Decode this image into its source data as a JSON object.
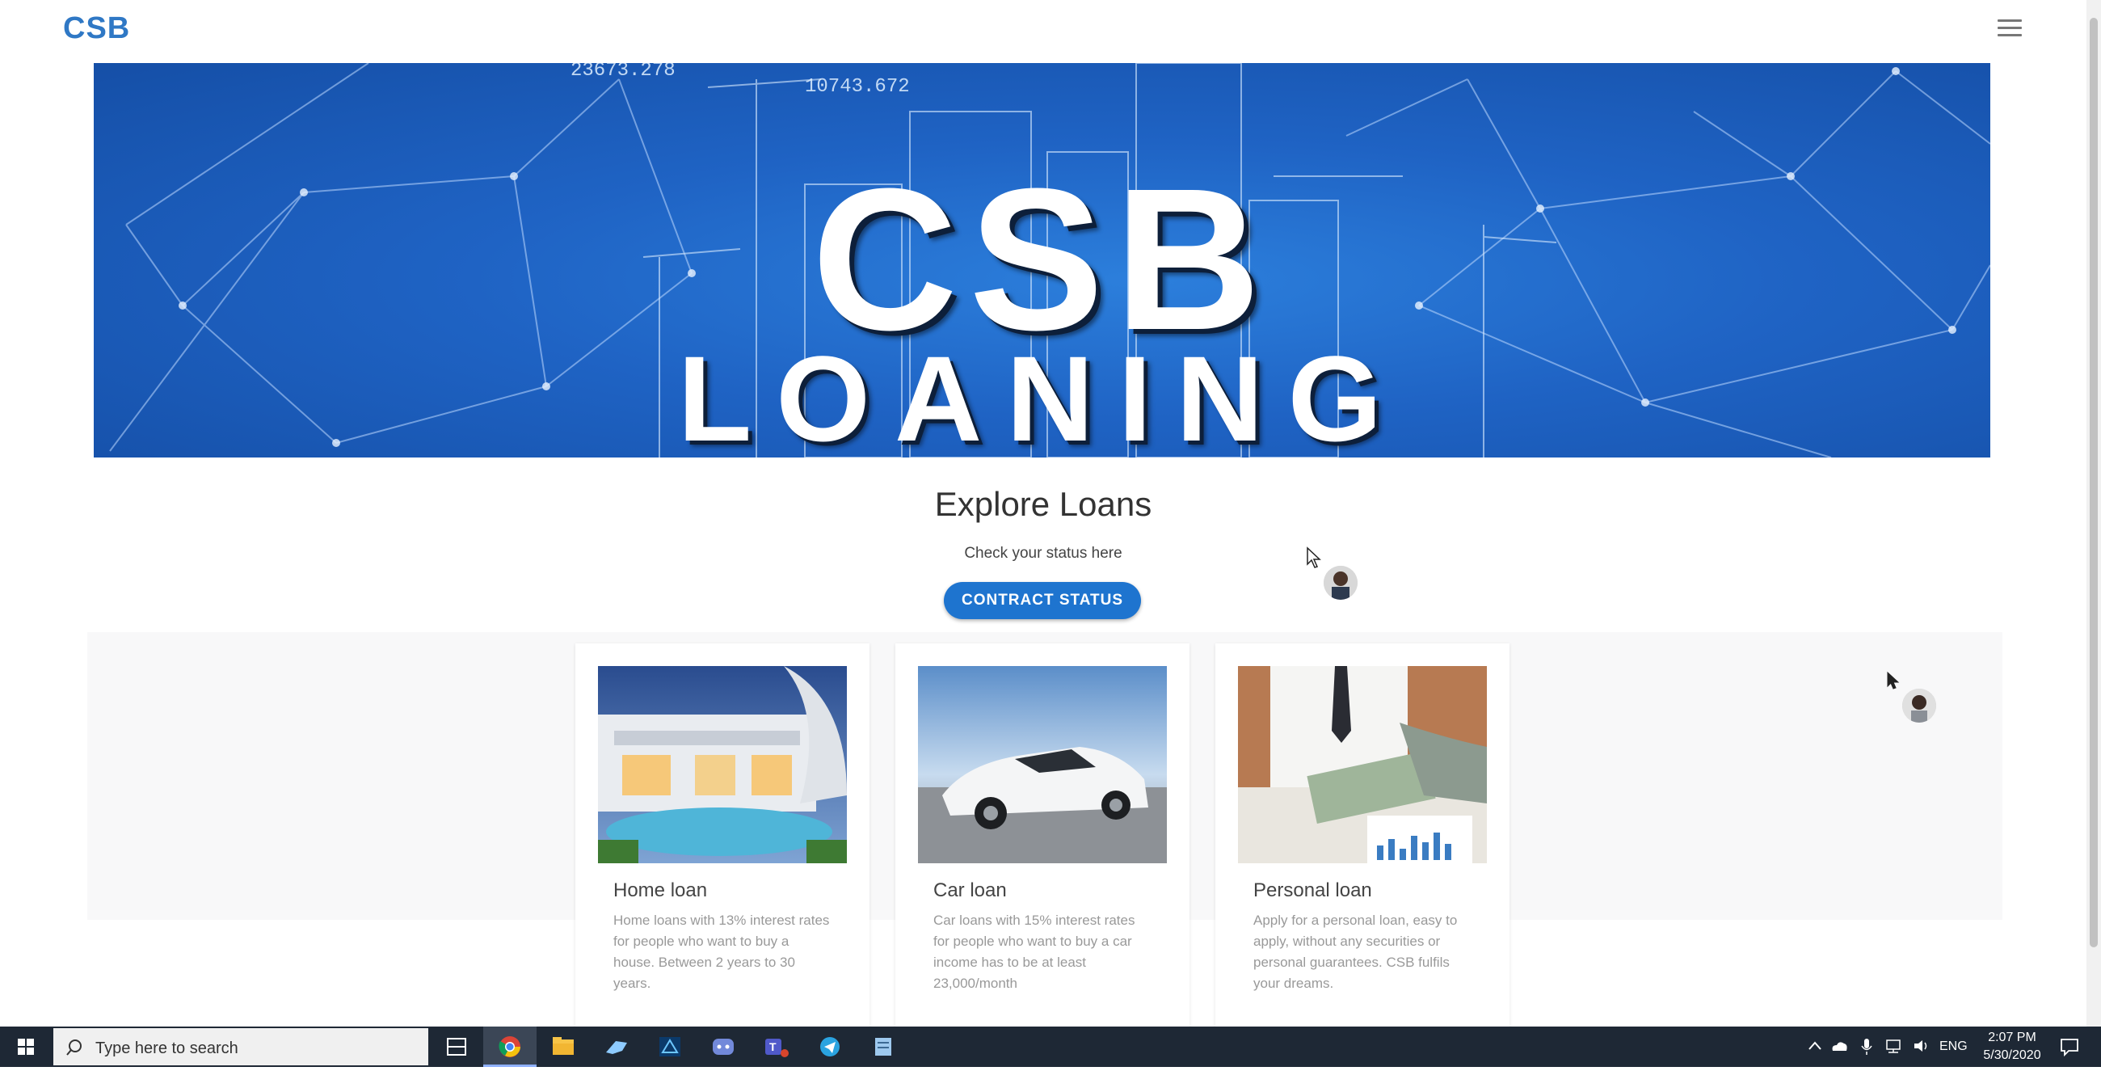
{
  "nav": {
    "brand": "CSB"
  },
  "hero": {
    "line1": "CSB",
    "line2": "LOANING",
    "numbers": [
      "23673.278",
      "10743.672"
    ]
  },
  "explore": {
    "title": "Explore Loans",
    "subtitle": "Check your status here",
    "button_label": "CONTRACT STATUS"
  },
  "cards": [
    {
      "title": "Home loan",
      "description": "Home loans with 13% interest rates for people who want to buy a house. Between 2 years to 30 years."
    },
    {
      "title": "Car loan",
      "description": "Car loans with 15% interest rates for people who want to buy a car income has to be at least 23,000/month"
    },
    {
      "title": "Personal loan",
      "description": "Apply for a personal loan, easy to apply, without any securities or personal guarantees. CSB fulfils your dreams."
    }
  ],
  "taskbar": {
    "search_placeholder": "Type here to search",
    "language": "ENG",
    "time": "2:07 PM",
    "date": "5/30/2020",
    "pinned_icons": [
      "task-view-icon",
      "chrome-icon",
      "file-explorer-icon",
      "steam-icon",
      "app-icon",
      "discord-icon",
      "teams-icon",
      "telegram-icon",
      "notepad-icon"
    ]
  },
  "colors": {
    "brand": "#2f78c5",
    "button": "#1e74cf",
    "hero_bg": "#1f63c4",
    "taskbar": "#1e2835"
  }
}
